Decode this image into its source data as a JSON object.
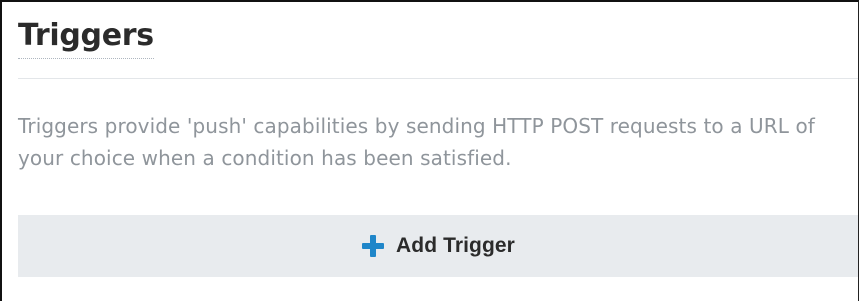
{
  "section": {
    "title": "Triggers",
    "description": "Triggers provide 'push' capabilities by sending HTTP POST requests to a URL of your choice when a condition has been satisfied.",
    "add_button": {
      "label": "Add Trigger",
      "icon": "plus-icon"
    }
  },
  "colors": {
    "accent": "#1f86c9",
    "title_text": "#2b2b2b",
    "description_text": "#8f959b",
    "button_background": "#e8ebee"
  }
}
